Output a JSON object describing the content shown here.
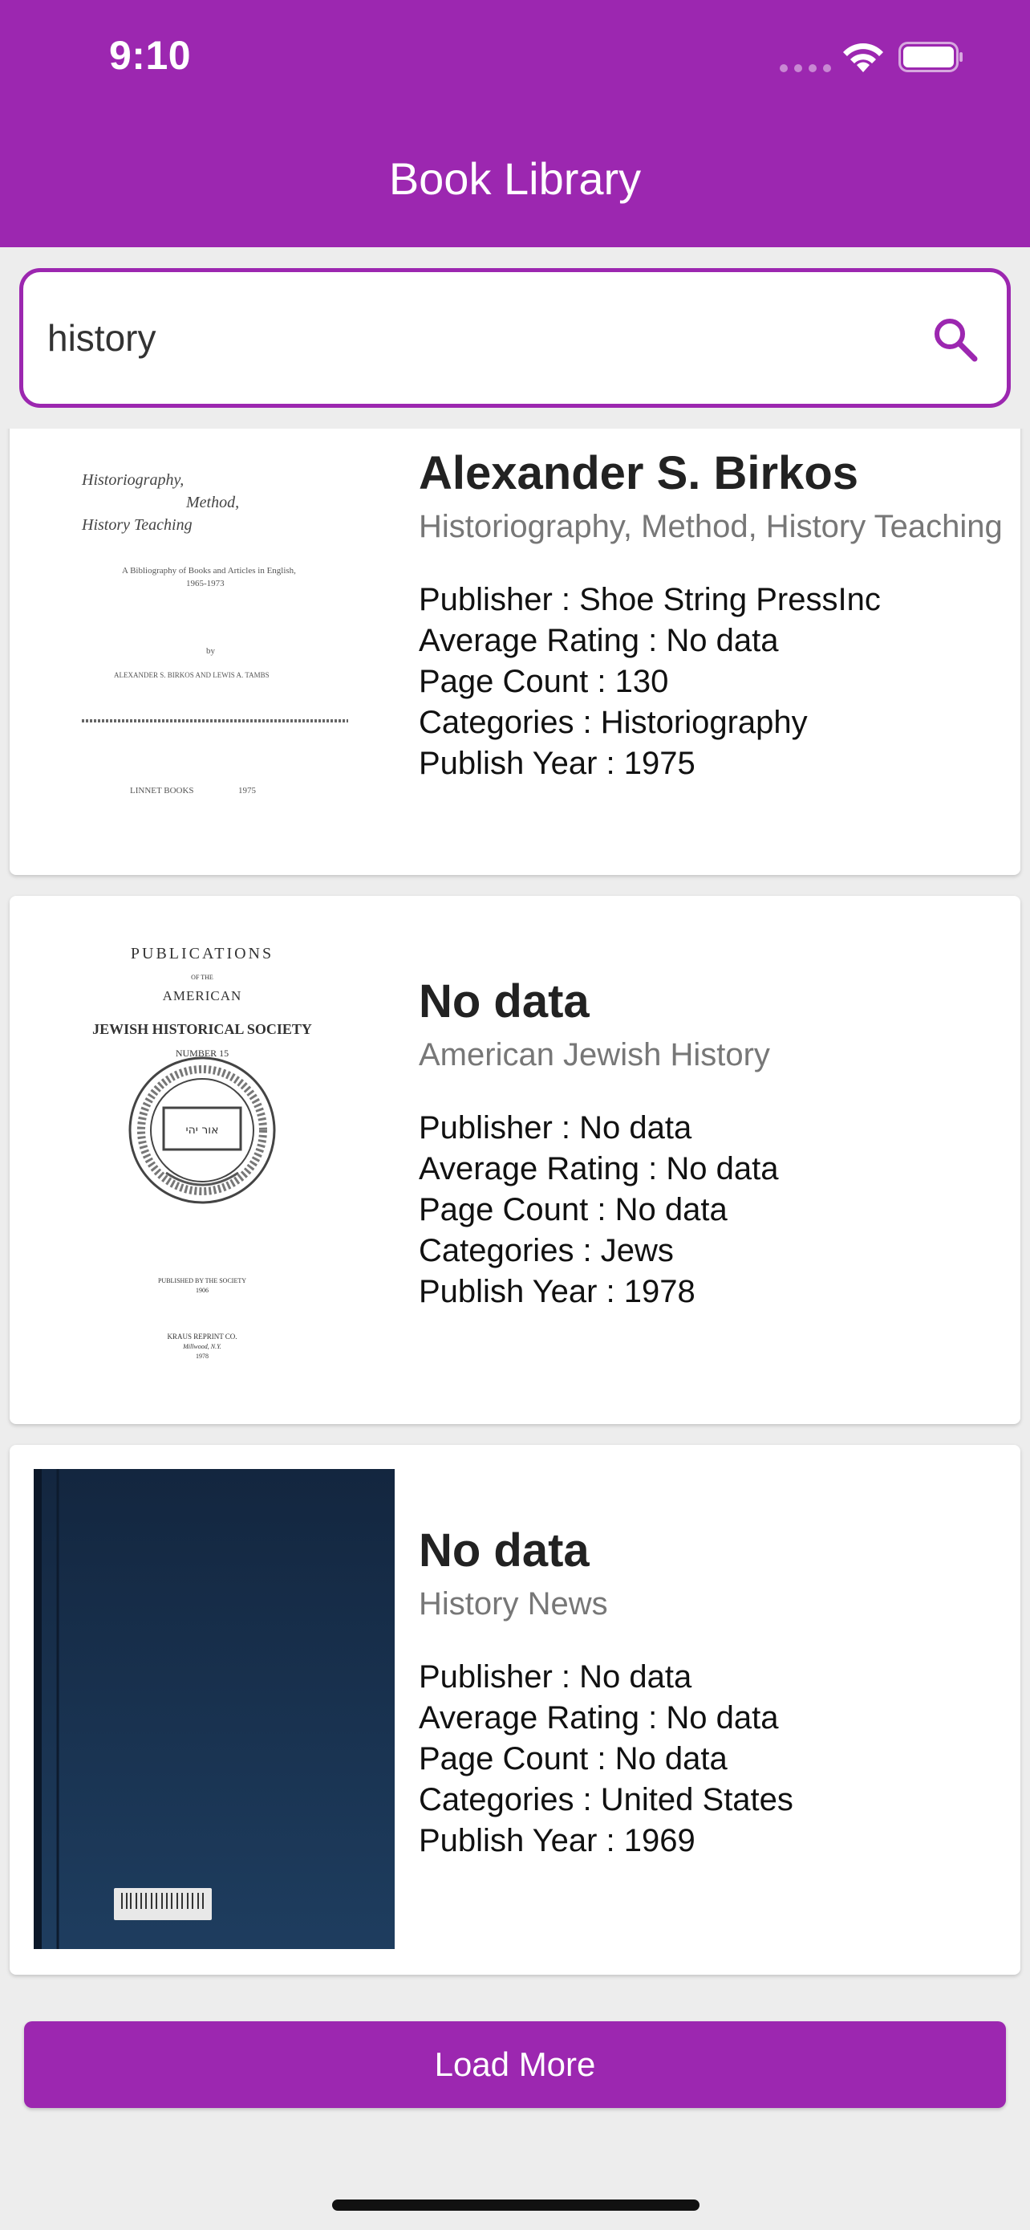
{
  "status_bar": {
    "time": "9:10"
  },
  "app_bar": {
    "title": "Book Library"
  },
  "search": {
    "value": "history"
  },
  "books": [
    {
      "title": "Alexander S. Birkos",
      "subtitle": "Historiography, Method, History Teaching",
      "publisher": "Publisher : Shoe String PressInc",
      "rating": "Average Rating : No data",
      "pages": "Page Count : 130",
      "categories": "Categories : Historiography",
      "year": "Publish Year : 1975",
      "cover_text": {
        "title": "Historiography, Method, History Teaching",
        "sub": "A Bibliography of Books and Articles in English, 1965-1973",
        "by": "by",
        "authors": "ALEXANDER S. BIRKOS AND LEWIS A. TAMBS",
        "imprint": "LINNET BOOKS",
        "year": "1975"
      }
    },
    {
      "title": "No data",
      "subtitle": "American Jewish History",
      "publisher": "Publisher : No data",
      "rating": "Average Rating : No data",
      "pages": "Page Count : No data",
      "categories": "Categories : Jews",
      "year": "Publish Year : 1978",
      "cover_text": {
        "line1": "PUBLICATIONS",
        "line2": "OF THE",
        "line3": "AMERICAN",
        "line4": "JEWISH HISTORICAL SOCIETY",
        "line5": "NUMBER 15",
        "seal": "אור יהי",
        "pub1": "PUBLISHED BY THE SOCIETY",
        "pub2": "1906",
        "pub3": "KRAUS REPRINT CO.",
        "pub4": "Millwood, N.Y.",
        "pub5": "1978"
      }
    },
    {
      "title": "No data",
      "subtitle": "History News",
      "publisher": "Publisher : No data",
      "rating": "Average Rating : No data",
      "pages": "Page Count : No data",
      "categories": "Categories : United States",
      "year": "Publish Year : 1969"
    }
  ],
  "load_more_label": "Load More",
  "colors": {
    "primary": "#9c27b0",
    "background": "#ededed",
    "card": "#ffffff",
    "dark_cover": "#12263f"
  }
}
